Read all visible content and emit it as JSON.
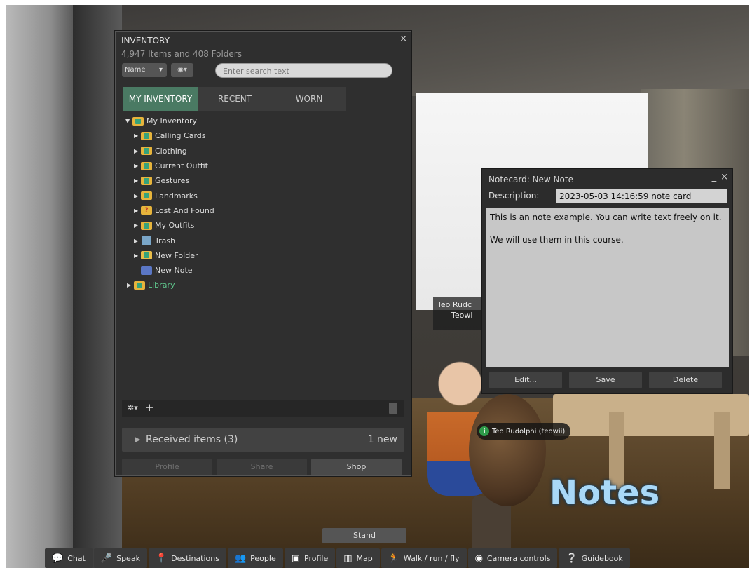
{
  "inventory": {
    "title": "INVENTORY",
    "count_text": "4,947 Items and 408 Folders",
    "sort_value": "Name",
    "search_placeholder": "Enter search text",
    "tabs": [
      {
        "label": "MY INVENTORY"
      },
      {
        "label": "RECENT"
      },
      {
        "label": "WORN"
      }
    ],
    "tree": {
      "root": "My Inventory",
      "items": [
        {
          "label": "Calling Cards"
        },
        {
          "label": "Clothing"
        },
        {
          "label": "Current Outfit"
        },
        {
          "label": "Gestures"
        },
        {
          "label": "Landmarks"
        },
        {
          "label": "Lost And Found"
        },
        {
          "label": "My Outfits"
        },
        {
          "label": "Trash"
        },
        {
          "label": "New Folder"
        },
        {
          "label": "New Note"
        }
      ],
      "library": "Library"
    },
    "received_label": "Received items (3)",
    "received_new": "1 new",
    "buttons": [
      {
        "label": "Profile"
      },
      {
        "label": "Share"
      },
      {
        "label": "Shop"
      }
    ]
  },
  "notecard": {
    "title": "Notecard: New Note",
    "description_label": "Description:",
    "description_value": "2023-05-03 14:16:59 note card",
    "body_line1": "This is an note example. You can write text freely on it.",
    "body_line2": "We will use them in this course.",
    "buttons": [
      {
        "label": "Edit..."
      },
      {
        "label": "Save"
      },
      {
        "label": "Delete"
      }
    ]
  },
  "scene": {
    "name_tag_top": "Teo Rudc",
    "name_tag_top_sub": "Teowi",
    "name_tag": "Teo Rudolphi (teowii)",
    "sign_text": "Notes"
  },
  "stand_label": "Stand",
  "toolbar": [
    {
      "label": "Chat",
      "icon": "chat-icon"
    },
    {
      "label": "Speak",
      "icon": "mic-icon"
    },
    {
      "label": "Destinations",
      "icon": "pin-icon"
    },
    {
      "label": "People",
      "icon": "people-icon"
    },
    {
      "label": "Profile",
      "icon": "profile-icon"
    },
    {
      "label": "Map",
      "icon": "map-icon"
    },
    {
      "label": "Walk / run / fly",
      "icon": "walk-icon"
    },
    {
      "label": "Camera controls",
      "icon": "eye-icon"
    },
    {
      "label": "Guidebook",
      "icon": "guidebook-icon"
    }
  ]
}
